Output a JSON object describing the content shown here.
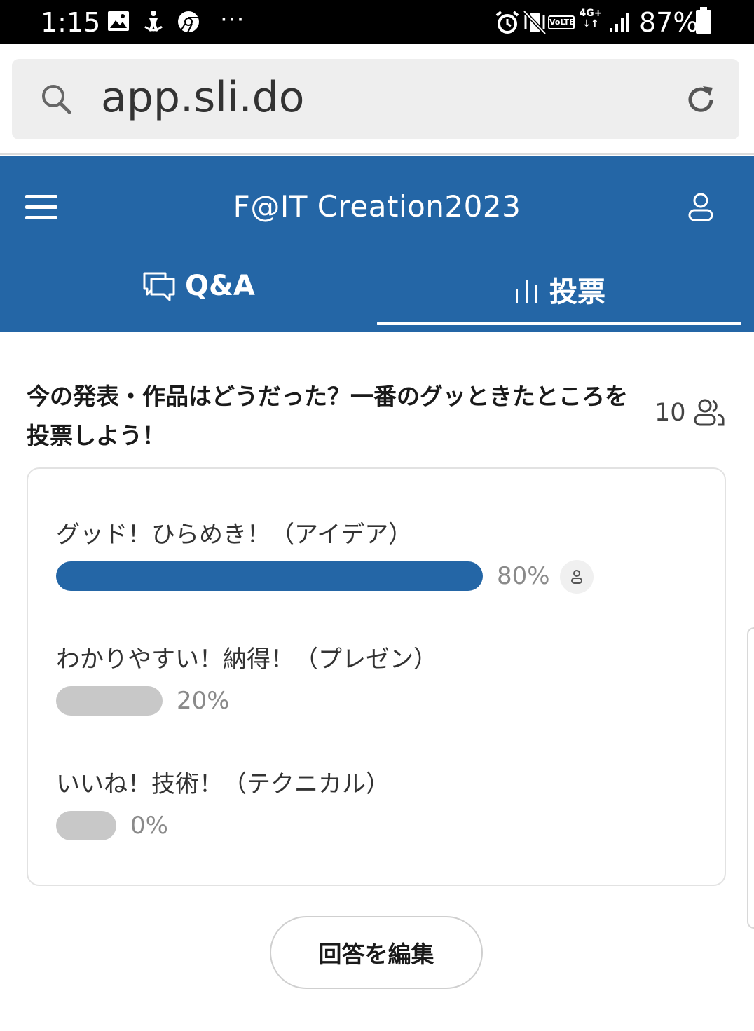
{
  "status_bar": {
    "time": "1:15",
    "dots": "···",
    "volte": "VoLTE",
    "network": "4G+",
    "battery": "87%"
  },
  "browser": {
    "url": "app.sli.do"
  },
  "header": {
    "event_title": "F@IT Creation2023",
    "tabs": [
      {
        "label": "Q&A",
        "icon": "chat-bubbles-icon",
        "active": false
      },
      {
        "label": "投票",
        "icon": "bar-chart-icon",
        "active": true
      }
    ]
  },
  "poll": {
    "question": "今の発表・作品はどうだった？一番のグッときたところを投票しよう！",
    "participants": "10",
    "options": [
      {
        "label": "グッド！ひらめき！（アイデア）",
        "percent_text": "80%",
        "percent": 80,
        "my_vote": true
      },
      {
        "label": "わかりやすい！納得！（プレゼン）",
        "percent_text": "20%",
        "percent": 20,
        "my_vote": false
      },
      {
        "label": "いいね！技術！（テクニカル）",
        "percent_text": "0%",
        "percent": 0,
        "my_vote": false
      }
    ],
    "edit_button": "回答を編集"
  },
  "colors": {
    "brand": "#2466a6",
    "bar_inactive": "#c8c8c8"
  }
}
